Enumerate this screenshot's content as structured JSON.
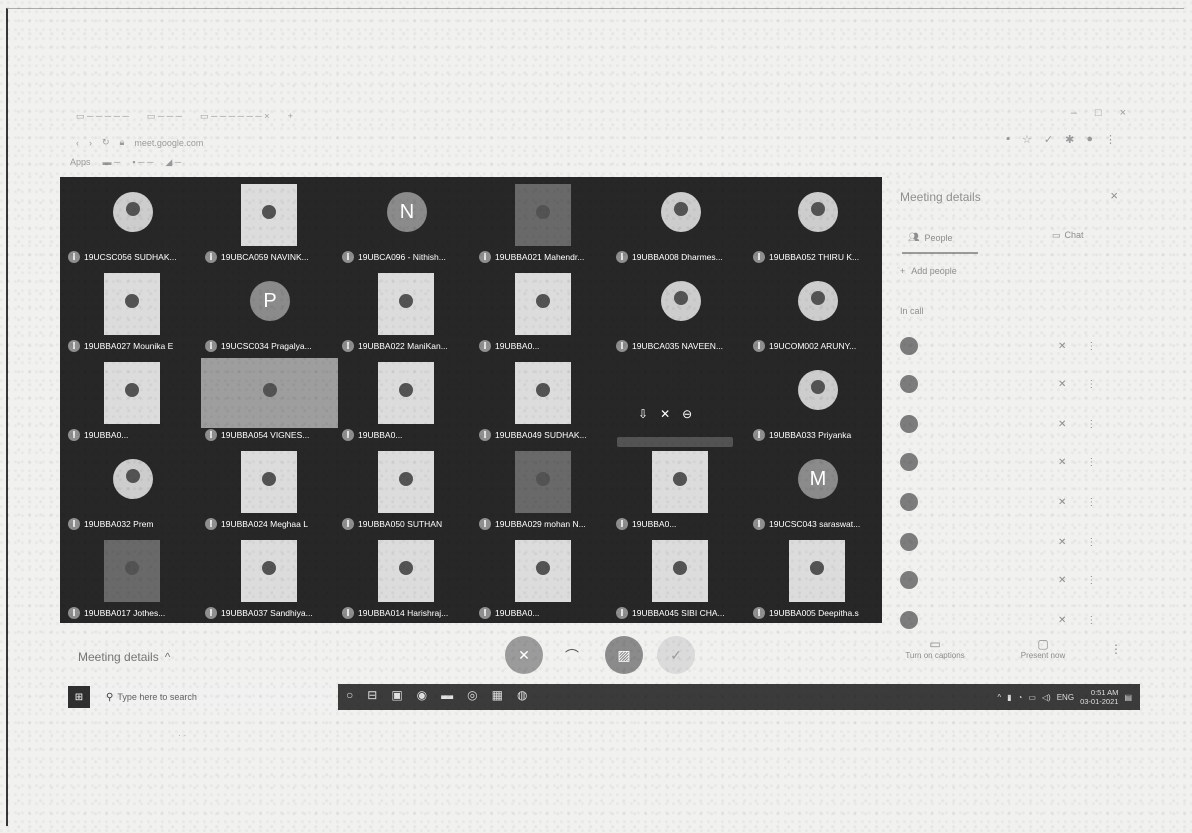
{
  "browser": {
    "tabs": [
      "",
      "",
      ""
    ],
    "url": "meet.google.com",
    "bookmarks": [
      "Apps",
      "",
      "",
      ""
    ]
  },
  "participants": [
    {
      "name": "19UCSC056 SUDHAK...",
      "kind": "circle"
    },
    {
      "name": "19UBCA059 NAVINK...",
      "kind": "rect"
    },
    {
      "name": "19UBCA096 - Nithish...",
      "kind": "letter",
      "letter": "N"
    },
    {
      "name": "19UBBA021 Mahendr...",
      "kind": "dark"
    },
    {
      "name": "19UBBA008 Dharmes...",
      "kind": "circle"
    },
    {
      "name": "19UBBA052 THIRU K...",
      "kind": "circle"
    },
    {
      "name": "19UBBA027 Mounika E",
      "kind": "rect"
    },
    {
      "name": "19UCSC034 Pragalya...",
      "kind": "letter",
      "letter": "P"
    },
    {
      "name": "19UBBA022 ManiKan...",
      "kind": "rect"
    },
    {
      "name": "19UBBA0...",
      "kind": "rect"
    },
    {
      "name": "19UBCA035 NAVEEN...",
      "kind": "circle"
    },
    {
      "name": "19UCOM002 ARUNY...",
      "kind": "circle"
    },
    {
      "name": "19UBBA0...",
      "kind": "rect"
    },
    {
      "name": "19UBBA054 VIGNES...",
      "kind": "wide"
    },
    {
      "name": "19UBBA0...",
      "kind": "rect"
    },
    {
      "name": "19UBBA049 SUDHAK...",
      "kind": "rect"
    },
    {
      "name": "",
      "kind": "hover"
    },
    {
      "name": "19UBBA033 Priyanka",
      "kind": "circle"
    },
    {
      "name": "19UBBA032 Prem",
      "kind": "circle"
    },
    {
      "name": "19UBBA024 Meghaa L",
      "kind": "rect"
    },
    {
      "name": "19UBBA050 SUTHAN",
      "kind": "rect"
    },
    {
      "name": "19UBBA029 mohan N...",
      "kind": "dark"
    },
    {
      "name": "19UBBA0...",
      "kind": "rect"
    },
    {
      "name": "19UCSC043 saraswat...",
      "kind": "letter",
      "letter": "M"
    },
    {
      "name": "19UBBA017 Jothes...",
      "kind": "dark"
    },
    {
      "name": "19UBBA037 Sandhiya...",
      "kind": "rect"
    },
    {
      "name": "19UBBA014 Harishraj...",
      "kind": "rect"
    },
    {
      "name": "19UBBA0...",
      "kind": "rect"
    },
    {
      "name": "19UBBA045 SIBI CHA...",
      "kind": "rect"
    },
    {
      "name": "19UBBA005 Deepitha.s",
      "kind": "rect"
    }
  ],
  "panel": {
    "title": "Meeting details",
    "people_tab": "People",
    "chat_tab": "Chat",
    "add_people": "Add people",
    "in_call": "In call",
    "people": [
      {
        "name": ""
      },
      {
        "name": ""
      },
      {
        "name": ""
      },
      {
        "name": ""
      },
      {
        "name": ""
      },
      {
        "name": ""
      },
      {
        "name": ""
      },
      {
        "name": ""
      }
    ]
  },
  "controls": {
    "meeting_details_label": "Meeting details",
    "captions_label": "Turn on captions",
    "present_label": "Present now"
  },
  "taskbar": {
    "search_placeholder": "Type here to search",
    "lang": "ENG",
    "time": "0:51 AM",
    "date": "03-01-2021"
  }
}
